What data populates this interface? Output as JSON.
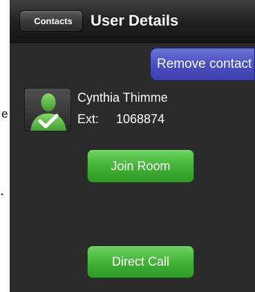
{
  "stray_text": {
    "left_char": "e",
    "left_dot": "."
  },
  "navbar": {
    "back_label": "Contacts",
    "title": "User Details"
  },
  "actions": {
    "remove_contact": "Remove contact",
    "join_room": "Join Room",
    "direct_call": "Direct Call"
  },
  "contact": {
    "name": "Cynthia Thimme",
    "ext_label": "Ext:",
    "ext_value": "1068874",
    "avatar_icon": "user-check-avatar-icon",
    "status_color": "#55b53f"
  },
  "colors": {
    "background": "#2b2b2b",
    "remove_button": "#4a50bf",
    "action_button": "#44b338"
  }
}
